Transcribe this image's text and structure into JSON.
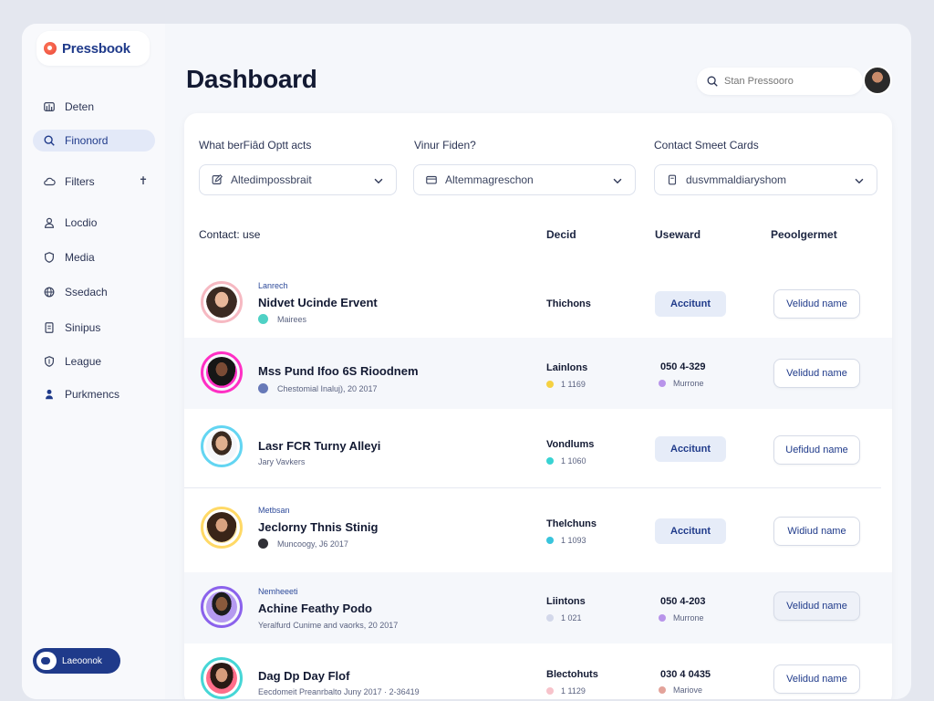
{
  "app": {
    "name": "Pressbook"
  },
  "sidebar": {
    "items": [
      {
        "label": "Deten",
        "icon": "dashboard-icon"
      },
      {
        "label": "Finonord",
        "icon": "search-icon",
        "active": true
      },
      {
        "label": "Filters",
        "icon": "cloud-icon",
        "pin": "✝"
      },
      {
        "label": "Locdio",
        "icon": "user-icon"
      },
      {
        "label": "Media",
        "icon": "shield-icon"
      },
      {
        "label": "Ssedach",
        "icon": "globe-icon"
      },
      {
        "label": "Sinipus",
        "icon": "document-icon"
      },
      {
        "label": "League",
        "icon": "shield-icon"
      },
      {
        "label": "Purkmencs",
        "icon": "person-icon"
      }
    ],
    "toggle_label": "Laeoonok"
  },
  "header": {
    "title": "Dashboard",
    "search_placeholder": "Stan Pressooro"
  },
  "filters": [
    {
      "label": "What berFiâd Optt acts",
      "value": "Altedimpossbrait"
    },
    {
      "label": "Vinur Fiden?",
      "value": "Altemmagreschon"
    },
    {
      "label": "Contact Smeet Cards",
      "value": "dusvmmaldiaryshom"
    }
  ],
  "columns": {
    "c1": "Contact: use",
    "c2": "Decid",
    "c3": "Useward",
    "c4": "Peoolgermet"
  },
  "rows": [
    {
      "tag": "Lanrech",
      "name": "Nidvet Ucinde Ervent",
      "sub": "Mairees",
      "c2_title": "Thichons",
      "c2_sub": "",
      "c3_button": "Accitunt",
      "c3_title": "",
      "c3_sub": "",
      "action": "Velidud name",
      "ring": "#f6b9c2",
      "dot": "#4fd1c5"
    },
    {
      "tag": "",
      "name": "Mss Pund Ifoo 6S Rioodnem",
      "sub": "Chestomial Inaluj), 20 2017",
      "c2_title": "Lainlons",
      "c2_sub": "1 1169",
      "c3_button": "",
      "c3_title": "050 4-329",
      "c3_sub": "Murrone",
      "action": "Velidud name",
      "ring": "#ff2fc4",
      "dot": "#6779b8"
    },
    {
      "tag": "",
      "name": "Lasr FCR Turny Alleyi",
      "sub": "Jary Vavkers",
      "c2_title": "Vondlums",
      "c2_sub": "1 1060",
      "c3_button": "Accitunt",
      "c3_title": "",
      "c3_sub": "",
      "action": "Uefidud name",
      "ring": "#63d5f2",
      "dot": ""
    },
    {
      "tag": "Metbsan",
      "name": "Jeclorny Thnis Stinig",
      "sub": "Muncoogy, J6 2017",
      "c2_title": "Thelchuns",
      "c2_sub": "1 1093",
      "c3_button": "Accitunt",
      "c3_title": "",
      "c3_sub": "",
      "action": "Widiud name",
      "ring": "#ffd966",
      "dot": "#2f2f35"
    },
    {
      "tag": "Nemheeeti",
      "name": "Achine Feathy Podo",
      "sub": "Yeralfurd Cunime and vaorks, 20 2017",
      "c2_title": "Liintons",
      "c2_sub": "1 021",
      "c3_button": "",
      "c3_title": "050 4-203",
      "c3_sub": "Murrone",
      "action": "Velidud name",
      "ring": "#8b62ec",
      "dot": ""
    },
    {
      "tag": "",
      "name": "Dag Dp Day Flof",
      "sub": "Eecdomeit Preanrbalto Juny 2017 · 2-36419",
      "c2_title": "Blectohuts",
      "c2_sub": "1 1129",
      "c3_button": "",
      "c3_title": "030 4 0435",
      "c3_sub": "Mariove",
      "action": "Velidud name",
      "ring": "#46d6d6",
      "dot": ""
    }
  ]
}
